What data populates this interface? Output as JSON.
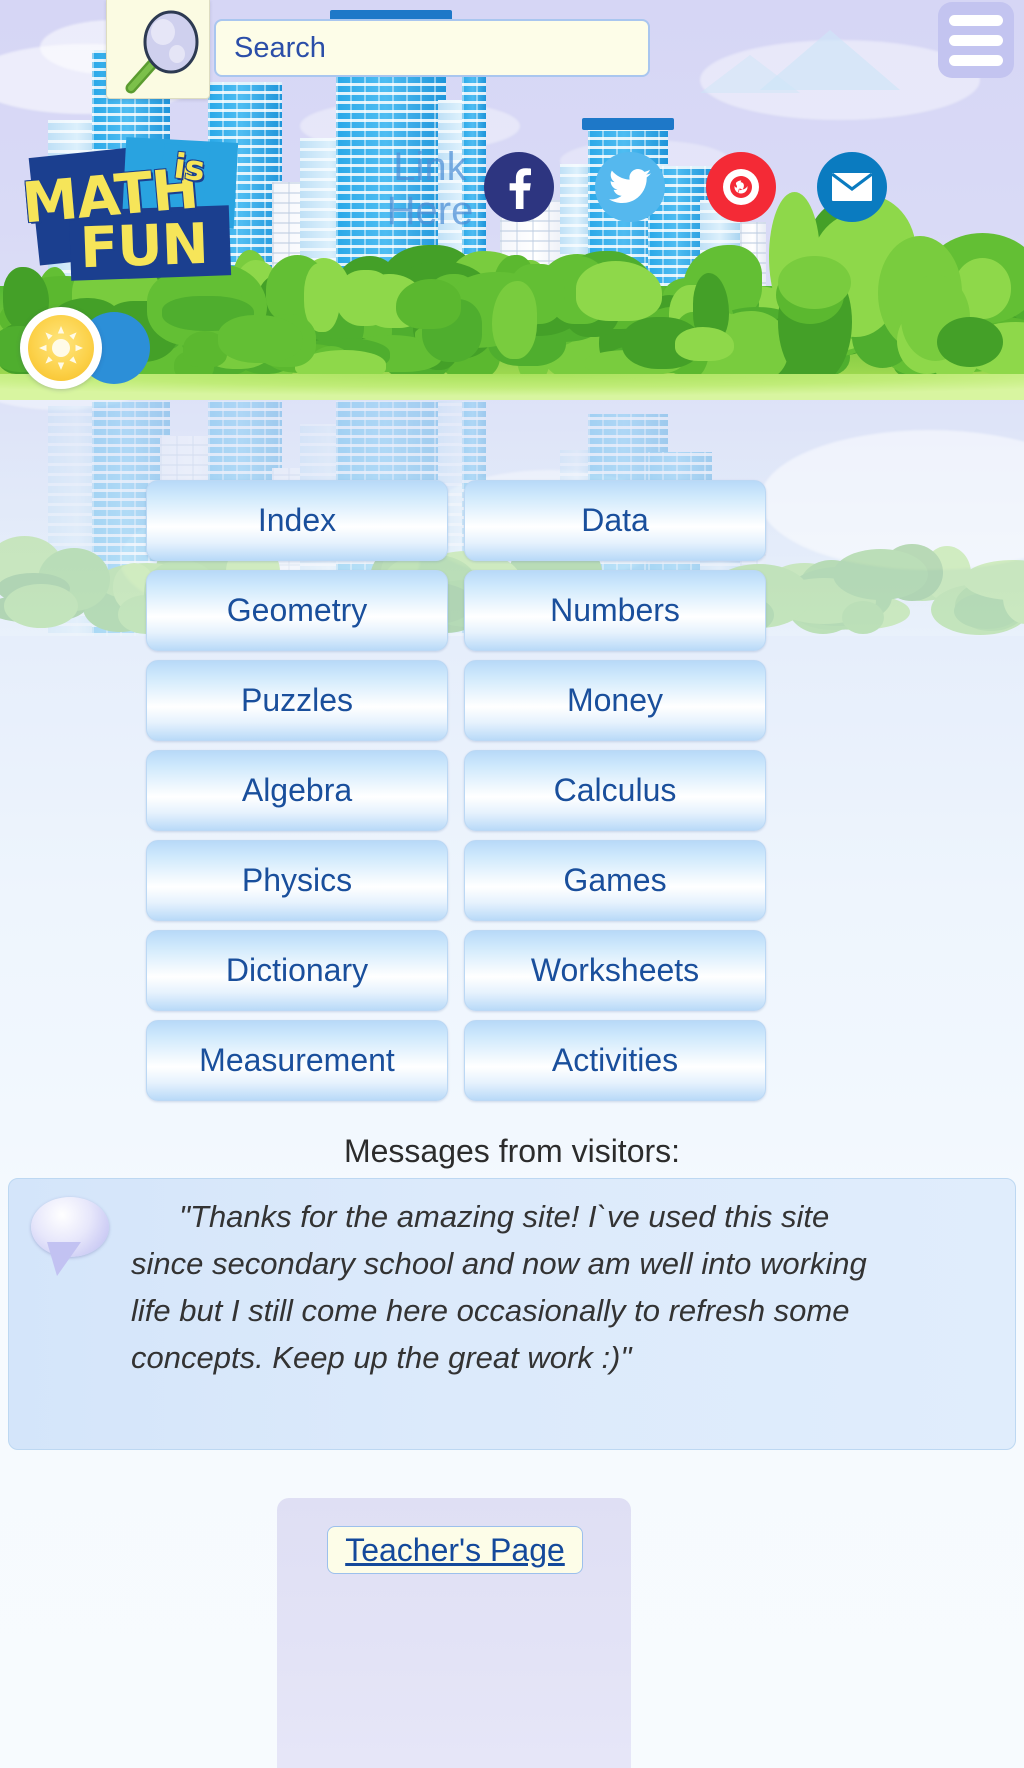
{
  "search": {
    "placeholder": "Search",
    "icon": "magnifier-icon"
  },
  "menu": {
    "icon": "hamburger-menu-icon"
  },
  "brand": {
    "word1": "MATH",
    "word2": "is",
    "word3": "FUN"
  },
  "banner": {
    "link_here": "Link Here",
    "sun_icon": "sun-icon"
  },
  "socials": [
    {
      "name": "facebook",
      "label": "f",
      "color": "#2d3580"
    },
    {
      "name": "twitter",
      "label": "t",
      "color": "#55b8ee"
    },
    {
      "name": "pinterest",
      "label": "P",
      "color": "#f42a36"
    },
    {
      "name": "email",
      "label": "@",
      "color": "#0a7bc0"
    }
  ],
  "nav_buttons": [
    {
      "label": "Index"
    },
    {
      "label": "Data"
    },
    {
      "label": "Geometry"
    },
    {
      "label": "Numbers"
    },
    {
      "label": "Puzzles"
    },
    {
      "label": "Money"
    },
    {
      "label": "Algebra"
    },
    {
      "label": "Calculus"
    },
    {
      "label": "Physics"
    },
    {
      "label": "Games"
    },
    {
      "label": "Dictionary"
    },
    {
      "label": "Worksheets"
    },
    {
      "label": "Measurement"
    },
    {
      "label": "Activities"
    }
  ],
  "messages": {
    "title": "Messages from visitors:",
    "quote": "\"Thanks for the amazing site! I`ve used this site since secondary school and now am well into working life but I still come here occasionally to refresh some concepts. Keep up the great work :)\""
  },
  "footer": {
    "teacher_link": "Teacher's Page"
  },
  "colors": {
    "accent_blue": "#1a4f9c",
    "button_top": "#b8d9f8",
    "facebook": "#2d3580",
    "twitter": "#55b8ee",
    "pinterest": "#f42a36",
    "email": "#0a7bc0",
    "logo_yellow": "#f6e559",
    "logo_navy": "#1b3f8f"
  }
}
